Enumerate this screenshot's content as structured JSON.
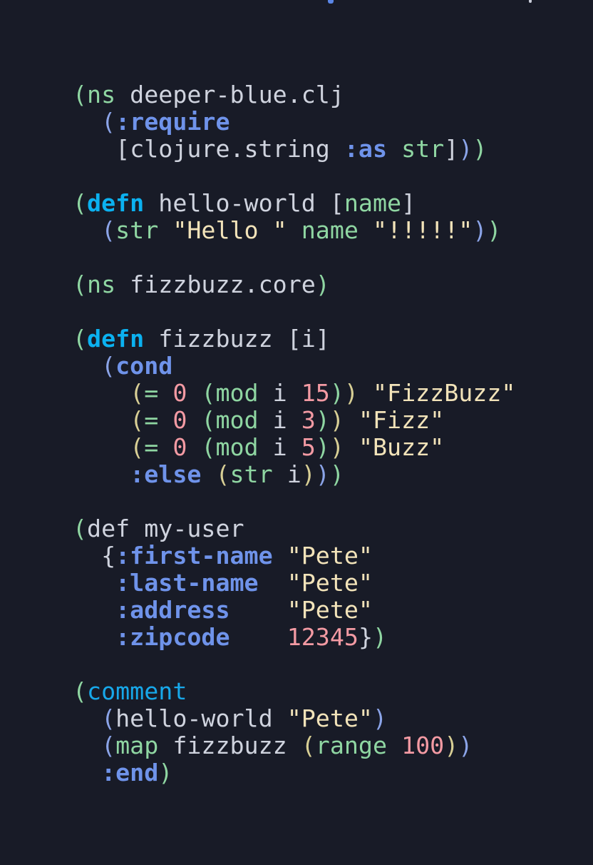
{
  "editor": {
    "lines": [
      [
        {
          "t": "(",
          "c": "green"
        },
        {
          "t": "ns",
          "c": "fn"
        },
        {
          "t": " deeper-blue.clj",
          "c": "sym"
        }
      ],
      [
        {
          "t": "  ",
          "c": "sym"
        },
        {
          "t": "(",
          "c": "blue"
        },
        {
          "t": ":require",
          "c": "kw"
        }
      ],
      [
        {
          "t": "   ",
          "c": "sym"
        },
        {
          "t": "[",
          "c": "sym"
        },
        {
          "t": "clojure.string ",
          "c": "sym"
        },
        {
          "t": ":as",
          "c": "kw"
        },
        {
          "t": " ",
          "c": "sym"
        },
        {
          "t": "str",
          "c": "fn"
        },
        {
          "t": "]",
          "c": "sym"
        },
        {
          "t": ")",
          "c": "blue"
        },
        {
          "t": ")",
          "c": "green"
        }
      ],
      [],
      [
        {
          "t": "(",
          "c": "green"
        },
        {
          "t": "defn",
          "c": "kw2"
        },
        {
          "t": " hello-world ",
          "c": "sym"
        },
        {
          "t": "[",
          "c": "sym"
        },
        {
          "t": "name",
          "c": "fn"
        },
        {
          "t": "]",
          "c": "sym"
        }
      ],
      [
        {
          "t": "  ",
          "c": "sym"
        },
        {
          "t": "(",
          "c": "blue"
        },
        {
          "t": "str",
          "c": "fn"
        },
        {
          "t": " ",
          "c": "sym"
        },
        {
          "t": "\"Hello \"",
          "c": "str"
        },
        {
          "t": " ",
          "c": "sym"
        },
        {
          "t": "name",
          "c": "fn"
        },
        {
          "t": " ",
          "c": "sym"
        },
        {
          "t": "\"!!!!!\"",
          "c": "str"
        },
        {
          "t": ")",
          "c": "blue"
        },
        {
          "t": ")",
          "c": "green"
        }
      ],
      [],
      [
        {
          "t": "(",
          "c": "green"
        },
        {
          "t": "ns",
          "c": "fn"
        },
        {
          "t": " fizzbuzz.core",
          "c": "sym"
        },
        {
          "t": ")",
          "c": "green"
        }
      ],
      [],
      [
        {
          "t": "(",
          "c": "green"
        },
        {
          "t": "defn",
          "c": "kw2"
        },
        {
          "t": " fizzbuzz ",
          "c": "sym"
        },
        {
          "t": "[i]",
          "c": "sym"
        }
      ],
      [
        {
          "t": "  ",
          "c": "sym"
        },
        {
          "t": "(",
          "c": "blue"
        },
        {
          "t": "cond",
          "c": "kw"
        }
      ],
      [
        {
          "t": "    ",
          "c": "sym"
        },
        {
          "t": "(",
          "c": "yellow"
        },
        {
          "t": "=",
          "c": "fn"
        },
        {
          "t": " ",
          "c": "sym"
        },
        {
          "t": "0",
          "c": "num"
        },
        {
          "t": " ",
          "c": "sym"
        },
        {
          "t": "(",
          "c": "green"
        },
        {
          "t": "mod",
          "c": "fn"
        },
        {
          "t": " i ",
          "c": "sym"
        },
        {
          "t": "15",
          "c": "num"
        },
        {
          "t": ")",
          "c": "green"
        },
        {
          "t": ")",
          "c": "yellow"
        },
        {
          "t": " ",
          "c": "sym"
        },
        {
          "t": "\"FizzBuzz\"",
          "c": "str"
        }
      ],
      [
        {
          "t": "    ",
          "c": "sym"
        },
        {
          "t": "(",
          "c": "yellow"
        },
        {
          "t": "=",
          "c": "fn"
        },
        {
          "t": " ",
          "c": "sym"
        },
        {
          "t": "0",
          "c": "num"
        },
        {
          "t": " ",
          "c": "sym"
        },
        {
          "t": "(",
          "c": "green"
        },
        {
          "t": "mod",
          "c": "fn"
        },
        {
          "t": " i ",
          "c": "sym"
        },
        {
          "t": "3",
          "c": "num"
        },
        {
          "t": ")",
          "c": "green"
        },
        {
          "t": ")",
          "c": "yellow"
        },
        {
          "t": " ",
          "c": "sym"
        },
        {
          "t": "\"Fizz\"",
          "c": "str"
        }
      ],
      [
        {
          "t": "    ",
          "c": "sym"
        },
        {
          "t": "(",
          "c": "yellow"
        },
        {
          "t": "=",
          "c": "fn"
        },
        {
          "t": " ",
          "c": "sym"
        },
        {
          "t": "0",
          "c": "num"
        },
        {
          "t": " ",
          "c": "sym"
        },
        {
          "t": "(",
          "c": "green"
        },
        {
          "t": "mod",
          "c": "fn"
        },
        {
          "t": " i ",
          "c": "sym"
        },
        {
          "t": "5",
          "c": "num"
        },
        {
          "t": ")",
          "c": "green"
        },
        {
          "t": ")",
          "c": "yellow"
        },
        {
          "t": " ",
          "c": "sym"
        },
        {
          "t": "\"Buzz\"",
          "c": "str"
        }
      ],
      [
        {
          "t": "    ",
          "c": "sym"
        },
        {
          "t": ":else",
          "c": "kw"
        },
        {
          "t": " ",
          "c": "sym"
        },
        {
          "t": "(",
          "c": "yellow"
        },
        {
          "t": "str",
          "c": "fn"
        },
        {
          "t": " i",
          "c": "sym"
        },
        {
          "t": ")",
          "c": "yellow"
        },
        {
          "t": ")",
          "c": "blue"
        },
        {
          "t": ")",
          "c": "green"
        }
      ],
      [],
      [
        {
          "t": "(",
          "c": "green"
        },
        {
          "t": "def my-user",
          "c": "sym"
        }
      ],
      [
        {
          "t": "  ",
          "c": "sym"
        },
        {
          "t": "{",
          "c": "sym"
        },
        {
          "t": ":first-name",
          "c": "kw"
        },
        {
          "t": " ",
          "c": "sym"
        },
        {
          "t": "\"Pete\"",
          "c": "str"
        }
      ],
      [
        {
          "t": "   ",
          "c": "sym"
        },
        {
          "t": ":last-name",
          "c": "kw"
        },
        {
          "t": "  ",
          "c": "sym"
        },
        {
          "t": "\"Pete\"",
          "c": "str"
        }
      ],
      [
        {
          "t": "   ",
          "c": "sym"
        },
        {
          "t": ":address",
          "c": "kw"
        },
        {
          "t": "    ",
          "c": "sym"
        },
        {
          "t": "\"Pete\"",
          "c": "str"
        }
      ],
      [
        {
          "t": "   ",
          "c": "sym"
        },
        {
          "t": ":zipcode",
          "c": "kw"
        },
        {
          "t": "    ",
          "c": "sym"
        },
        {
          "t": "12345",
          "c": "num"
        },
        {
          "t": "}",
          "c": "sym"
        },
        {
          "t": ")",
          "c": "green"
        }
      ],
      [],
      [
        {
          "t": "(",
          "c": "green"
        },
        {
          "t": "comment",
          "c": "comment-kw"
        }
      ],
      [
        {
          "t": "  ",
          "c": "sym"
        },
        {
          "t": "(",
          "c": "blue"
        },
        {
          "t": "hello-world ",
          "c": "sym"
        },
        {
          "t": "\"Pete\"",
          "c": "str"
        },
        {
          "t": ")",
          "c": "blue"
        }
      ],
      [
        {
          "t": "  ",
          "c": "sym"
        },
        {
          "t": "(",
          "c": "blue"
        },
        {
          "t": "map",
          "c": "fn"
        },
        {
          "t": " fizzbuzz ",
          "c": "sym"
        },
        {
          "t": "(",
          "c": "yellow"
        },
        {
          "t": "range",
          "c": "fn"
        },
        {
          "t": " ",
          "c": "sym"
        },
        {
          "t": "100",
          "c": "num"
        },
        {
          "t": ")",
          "c": "yellow"
        },
        {
          "t": ")",
          "c": "blue"
        }
      ],
      [
        {
          "t": "  ",
          "c": "sym"
        },
        {
          "t": ":end",
          "c": "kw"
        },
        {
          "t": ")",
          "c": "green"
        }
      ]
    ]
  }
}
